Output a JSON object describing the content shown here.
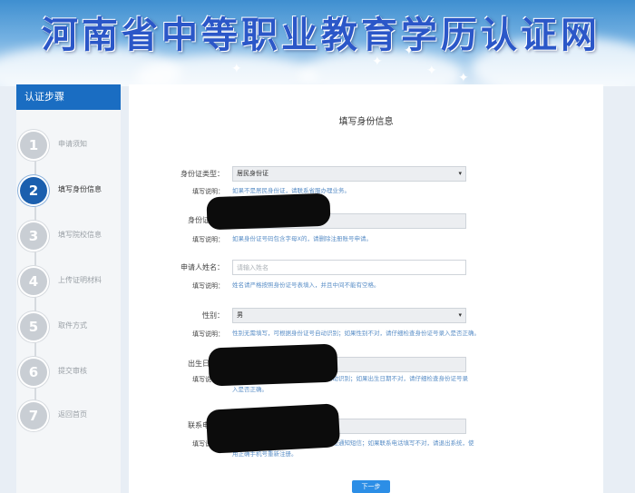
{
  "banner": {
    "title": "河南省中等职业教育学历认证网"
  },
  "sidebar": {
    "header": "认证步骤",
    "steps": [
      {
        "number": "1",
        "label": "申请须知",
        "active": false
      },
      {
        "number": "2",
        "label": "填写身份信息",
        "active": true
      },
      {
        "number": "3",
        "label": "填写院校信息",
        "active": false
      },
      {
        "number": "4",
        "label": "上传证明材料",
        "active": false
      },
      {
        "number": "5",
        "label": "取件方式",
        "active": false
      },
      {
        "number": "6",
        "label": "提交审核",
        "active": false
      },
      {
        "number": "7",
        "label": "返回首页",
        "active": false
      }
    ]
  },
  "form": {
    "title": "填写身份信息",
    "hint_label": "填写说明：",
    "id_type": {
      "label": "身份证类型：",
      "value": "居民身份证",
      "hint": "如果不是居民身份证，请联系省服办理业务。"
    },
    "id_number": {
      "label": "身份证号：",
      "hint": "如果身份证号码包含字母X的，请删除注册账号申请。"
    },
    "name": {
      "label": "申请人姓名：",
      "placeholder": "请输入姓名",
      "hint": "姓名请严格按照身份证号表填入，并且中间不能有空格。"
    },
    "gender": {
      "label": "性别：",
      "value": "男",
      "hint": "性别无需填写，可根据身份证号自动识别；如果性别不对，请仔细检查身份证号录入是否正确。"
    },
    "birth_date": {
      "label": "出生日期：",
      "hint": "出生日期无需填写，可根据身份证号自动识别；如果出生日期不对，请仔细检查身份证号录入是否正确。"
    },
    "phone": {
      "label": "联系电话：",
      "hint": "手机号用于接收审核结果通知短信和快递通知短信；如果联系电话填写不对，请退出系统，使用正确手机号重新注册。"
    },
    "next_button": "下一步"
  },
  "colors": {
    "accent": "#1a6dc2",
    "active_step": "#1b5fae",
    "hint_text": "#5b8fc7",
    "button": "#2c8ee6"
  }
}
